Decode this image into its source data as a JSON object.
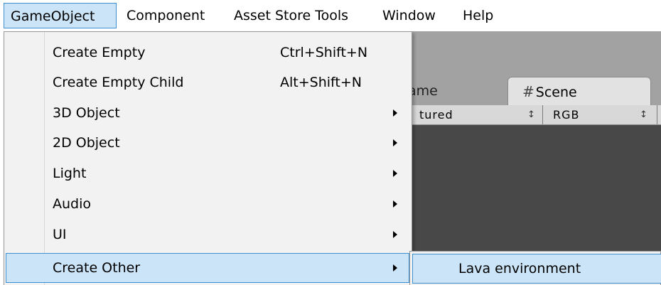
{
  "menubar": {
    "items": [
      {
        "label": "GameObject"
      },
      {
        "label": "Component"
      },
      {
        "label": "Asset Store Tools"
      },
      {
        "label": "Window"
      },
      {
        "label": "Help"
      }
    ]
  },
  "editor": {
    "tabs": [
      {
        "label": "ame"
      },
      {
        "label": "Scene",
        "icon": "hash-icon"
      }
    ],
    "toolbar": {
      "shading": "tured",
      "render_mode": "RGB",
      "arrow": "↕"
    },
    "hash_glyph": "#"
  },
  "dropdown": {
    "items": [
      {
        "label": "Create Empty",
        "shortcut": "Ctrl+Shift+N"
      },
      {
        "label": "Create Empty Child",
        "shortcut": "Alt+Shift+N"
      },
      {
        "label": "3D Object",
        "submenu": true
      },
      {
        "label": "2D Object",
        "submenu": true
      },
      {
        "label": "Light",
        "submenu": true
      },
      {
        "label": "Audio",
        "submenu": true
      },
      {
        "label": "UI",
        "submenu": true
      },
      {
        "label": "Create Other",
        "submenu": true,
        "highlighted": true
      }
    ]
  },
  "submenu": {
    "items": [
      {
        "label": "Lava environment",
        "highlighted": true
      }
    ]
  },
  "colors": {
    "highlight_fill": "#cce4f7",
    "highlight_border": "#3d8fd1",
    "menu_bg": "#f2f2f2",
    "editor_bg": "#a2a2a2",
    "viewport_bg": "#484848"
  }
}
